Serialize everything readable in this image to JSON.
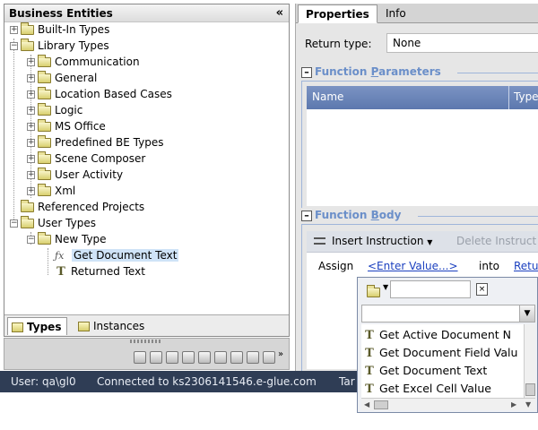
{
  "left_panel": {
    "title": "Business Entities",
    "collapse": "«",
    "tree": [
      {
        "label": "Built-In Types",
        "expander": "+"
      },
      {
        "label": "Library Types",
        "expander": "−"
      },
      {
        "label": "Communication",
        "expander": "+"
      },
      {
        "label": "General",
        "expander": "+"
      },
      {
        "label": "Location Based Cases",
        "expander": "+"
      },
      {
        "label": "Logic",
        "expander": "+"
      },
      {
        "label": "MS Office",
        "expander": "+"
      },
      {
        "label": "Predefined BE Types",
        "expander": "+"
      },
      {
        "label": "Scene Composer",
        "expander": "+"
      },
      {
        "label": "User Activity",
        "expander": "+"
      },
      {
        "label": "Xml",
        "expander": "+"
      },
      {
        "label": "Referenced Projects",
        "expander": ""
      },
      {
        "label": "User Types",
        "expander": "−"
      },
      {
        "label": "New Type",
        "expander": "−"
      },
      {
        "label": "Get Document Text",
        "expander": ""
      },
      {
        "label": "Returned Text",
        "expander": ""
      }
    ],
    "icons": {
      "fx": "ƒx",
      "t": "T"
    },
    "tabs": {
      "types": "Types",
      "instances": "Instances"
    }
  },
  "status_bar": {
    "user": "User: qa\\gl0",
    "connection": "Connected to ks2306141546.e-glue.com",
    "extra": "Tar"
  },
  "right_panel": {
    "tabs": {
      "properties": "Properties",
      "info": "Info"
    },
    "return_type_label": "Return type:",
    "return_type_value": "None",
    "function_parameters": {
      "title_pre": "Function ",
      "title_accel": "P",
      "title_post": "arameters",
      "columns": [
        "Name",
        "Type"
      ]
    },
    "function_body": {
      "title_pre": "Function ",
      "title_accel": "B",
      "title_post": "ody",
      "insert_instruction": "Insert Instruction",
      "delete_instruction": "Delete Instruct",
      "assign": "Assign",
      "enter_value": "<Enter Value...>",
      "into": "into",
      "retu": "Retu"
    }
  },
  "popup": {
    "items": [
      "Get Active Document N",
      "Get Document Field Valu",
      "Get Document Text",
      "Get Excel Cell Value"
    ]
  },
  "colors": {
    "status_bg": "#2f3d55",
    "section_title": "#6b8fc9",
    "header_blue": "#6a84b8",
    "link": "#1a3fbf"
  }
}
